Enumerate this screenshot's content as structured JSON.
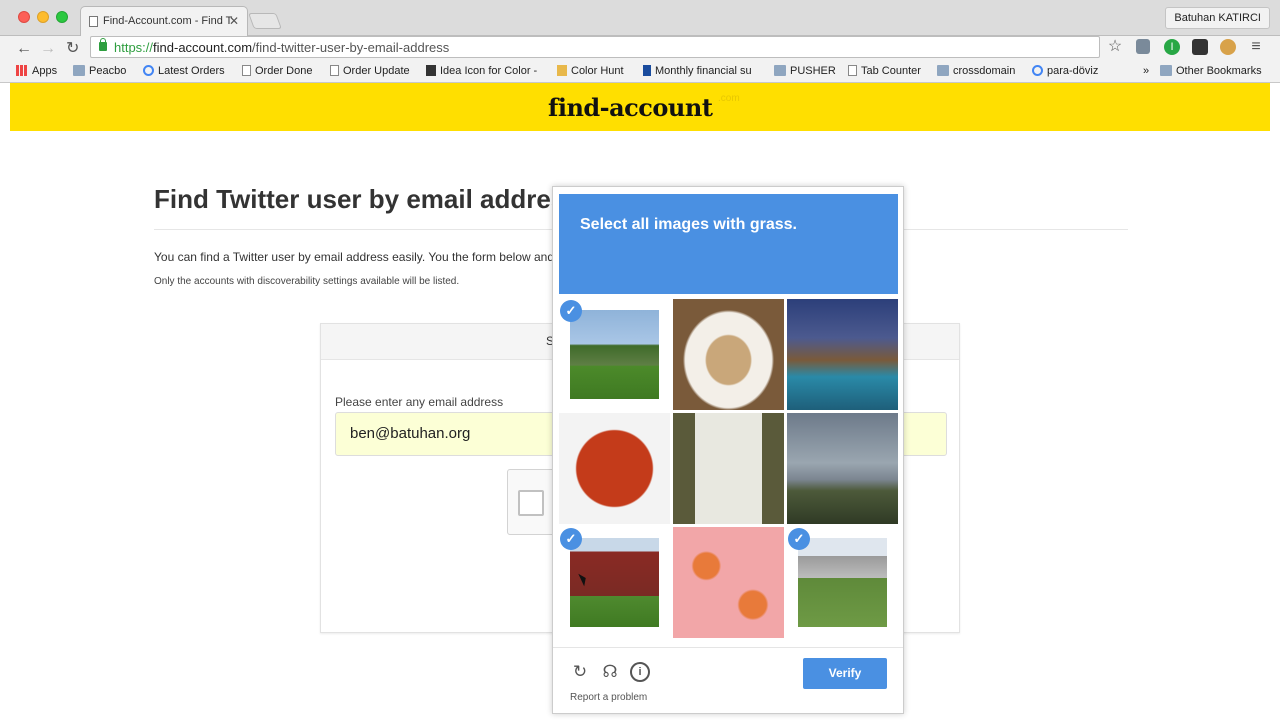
{
  "browser": {
    "tab_title": "Find-Account.com - Find T",
    "profile_name": "Batuhan KATIRCI",
    "url_scheme": "https://",
    "url_host": "find-account.com",
    "url_path": "/find-twitter-user-by-email-address",
    "bookmarks": [
      {
        "label": "Apps",
        "icon": "apps-grid-icon"
      },
      {
        "label": "Peacbo",
        "icon": "folder-icon"
      },
      {
        "label": "Latest Orders",
        "icon": "google-icon"
      },
      {
        "label": "Order Done",
        "icon": "page-icon"
      },
      {
        "label": "Order Update",
        "icon": "page-icon"
      },
      {
        "label": "Idea Icon for Color -",
        "icon": "site-icon"
      },
      {
        "label": "Color Hunt",
        "icon": "site-icon"
      },
      {
        "label": "Monthly financial su",
        "icon": "paypal-icon"
      },
      {
        "label": "PUSHER",
        "icon": "folder-icon"
      },
      {
        "label": "Tab Counter",
        "icon": "page-icon"
      },
      {
        "label": "crossdomain",
        "icon": "folder-icon"
      },
      {
        "label": "para-döviz",
        "icon": "google-icon"
      }
    ],
    "overflow_label": "»",
    "other_bookmarks": "Other Bookmarks"
  },
  "site": {
    "logo": "find-account",
    "logo_suffix": ".com",
    "accent_color": "#ffdf00"
  },
  "main": {
    "heading": "Find Twitter user by email address",
    "intro": "You can find a Twitter user by email address easily. You the form below and sea",
    "note": "Only the accounts with discoverability settings available will be listed.",
    "card_header_fragment": "S",
    "email_label": "Please enter any email address",
    "email_value": "ben@batuhan.org"
  },
  "captcha": {
    "prompt_prefix": "Select all images with ",
    "prompt_keyword": "grass.",
    "accent_color": "#4a90e2",
    "tiles": [
      {
        "subject": "green hill with grass",
        "selected": true
      },
      {
        "subject": "cookies on plate",
        "selected": false
      },
      {
        "subject": "pool at dusk",
        "selected": false
      },
      {
        "subject": "red spiral sausage",
        "selected": false
      },
      {
        "subject": "banquet table",
        "selected": false
      },
      {
        "subject": "river shore",
        "selected": false
      },
      {
        "subject": "barn with grass",
        "selected": true
      },
      {
        "subject": "pink food",
        "selected": false
      },
      {
        "subject": "lawn with buildings",
        "selected": true
      }
    ],
    "reload_icon": "reload-icon",
    "audio_icon": "headphones-icon",
    "info_icon": "info-icon",
    "verify_label": "Verify",
    "report_label": "Report a problem"
  }
}
